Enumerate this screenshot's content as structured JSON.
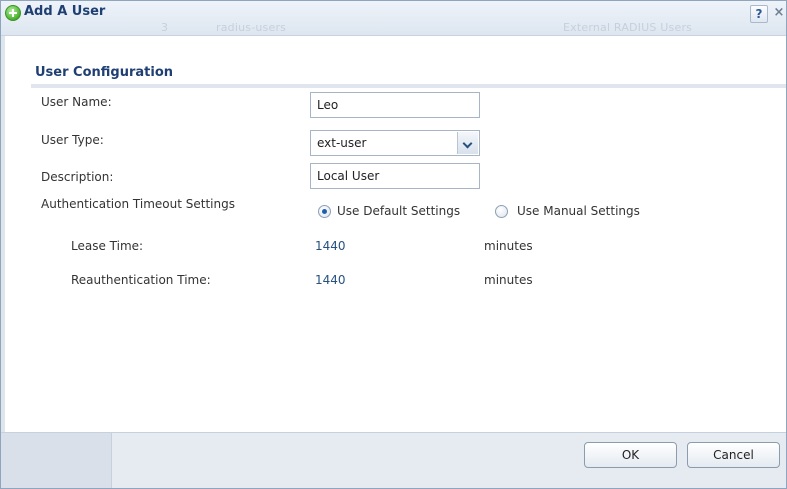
{
  "dialog": {
    "title": "Add A User",
    "help_label": "?",
    "close_label": "×",
    "background_ghost_text": [
      "radius-users",
      "External RADIUS Users"
    ]
  },
  "section": {
    "title": "User Configuration"
  },
  "form": {
    "user_name": {
      "label": "User Name:",
      "value": "Leo"
    },
    "user_type": {
      "label": "User Type:",
      "value": "ext-user"
    },
    "description": {
      "label": "Description:",
      "value": "Local User"
    },
    "auth_timeout": {
      "label": "Authentication Timeout Settings",
      "options": [
        {
          "label": "Use Default Settings",
          "checked": true
        },
        {
          "label": "Use Manual Settings",
          "checked": false
        }
      ]
    },
    "lease_time": {
      "label": "Lease Time:",
      "value": "1440",
      "unit": "minutes"
    },
    "reauth_time": {
      "label": "Reauthentication Time:",
      "value": "1440",
      "unit": "minutes"
    }
  },
  "footer": {
    "ok_label": "OK",
    "cancel_label": "Cancel"
  }
}
